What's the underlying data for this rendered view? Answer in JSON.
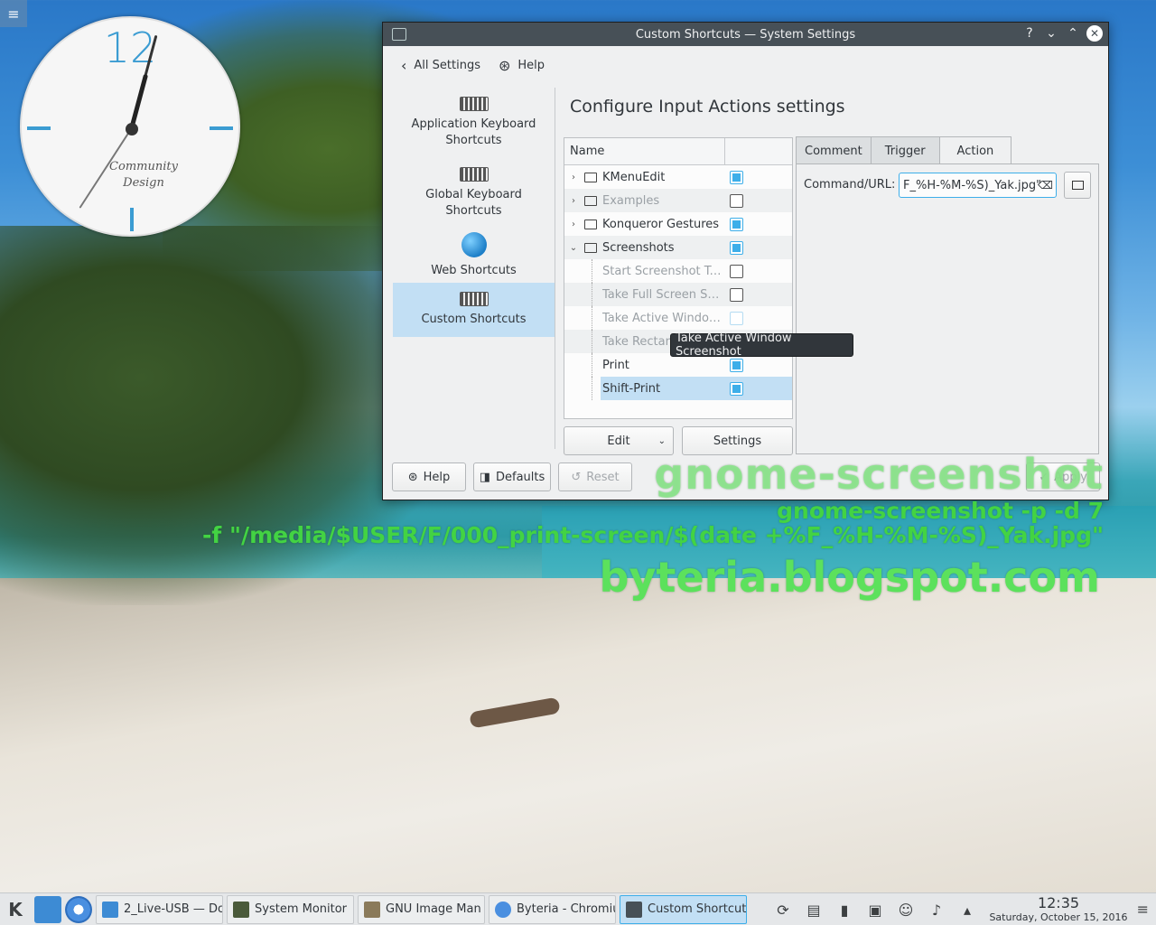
{
  "desktop": {
    "clock": {
      "hour_label": "12",
      "brand_line1": "Community",
      "brand_line2": "Design"
    },
    "overlay": {
      "line1": "gnome-screenshot",
      "line2": "gnome-screenshot -p -d 7",
      "line3": "-f \"/media/$USER/F/000_print-screen/$(date +%F_%H-%M-%S)_Yak.jpg\"",
      "line4": "byteria.blogspot.com"
    }
  },
  "window": {
    "title": "Custom Shortcuts  — System Settings",
    "titlebar_buttons": [
      "?",
      "⌄",
      "⌃",
      "✕"
    ],
    "toolbar": {
      "back_label": "All Settings",
      "help_label": "Help"
    },
    "sidebar": {
      "items": [
        {
          "label": "Application Keyboard Shortcuts",
          "icon": "keyboard-icon"
        },
        {
          "label": "Global Keyboard Shortcuts",
          "icon": "keyboard-icon"
        },
        {
          "label": "Web Shortcuts",
          "icon": "globe-icon"
        },
        {
          "label": "Custom Shortcuts",
          "icon": "keyboard-icon",
          "selected": true
        }
      ]
    },
    "page_title": "Configure Input Actions settings",
    "tree": {
      "header": "Name",
      "rows": [
        {
          "label": "KMenuEdit",
          "type": "folder",
          "expanded": false,
          "checked": true
        },
        {
          "label": "Examples",
          "type": "folder",
          "expanded": false,
          "checked": false,
          "dim": true
        },
        {
          "label": "Konqueror Gestures",
          "type": "folder",
          "expanded": false,
          "checked": true
        },
        {
          "label": "Screenshots",
          "type": "folder",
          "expanded": true,
          "checked": true
        },
        {
          "label": "Start Screenshot Tool",
          "type": "leaf",
          "checked": false,
          "dim": true
        },
        {
          "label": "Take Full Screen Scr...",
          "type": "leaf",
          "checked": false,
          "dim": true
        },
        {
          "label": "Take Active Window...",
          "type": "leaf",
          "checked": false,
          "dim": true
        },
        {
          "label": "Take Rectang",
          "type": "leaf",
          "checked": false,
          "dim": true
        },
        {
          "label": "Print",
          "type": "leaf",
          "checked": true
        },
        {
          "label": "Shift-Print",
          "type": "leaf",
          "checked": true,
          "selected": true
        }
      ]
    },
    "edit_button": "Edit",
    "settings_button": "Settings",
    "tabs": [
      "Comment",
      "Trigger",
      "Action"
    ],
    "active_tab": "Action",
    "action": {
      "command_label": "Command/URL:",
      "command_value": "F_%H-%M-%S)_Yak.jpg\""
    },
    "tooltip": "Take Active Window Screenshot",
    "footer": {
      "help": "Help",
      "defaults": "Defaults",
      "reset": "Reset",
      "apply": "Apply"
    }
  },
  "taskbar": {
    "tasks": [
      {
        "label": "2_Live-USB — Do",
        "color": "#3d8bd4"
      },
      {
        "label": "System Monitor",
        "color": "#4a5a3a"
      },
      {
        "label": "GNU Image Man",
        "color": "#8a7a5a"
      },
      {
        "label": "Byteria - Chromiu",
        "color": "#4a8fe0"
      },
      {
        "label": "Custom Shortcut",
        "color": "#475057",
        "active": true
      }
    ],
    "time": "12:35",
    "date": "Saturday, October 15, 2016"
  }
}
